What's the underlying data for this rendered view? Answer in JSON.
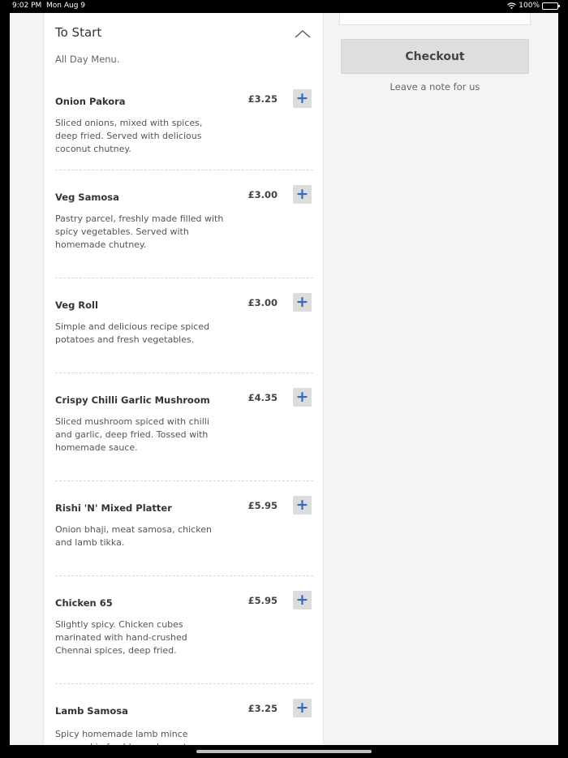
{
  "status": {
    "time": "9:02 PM",
    "date": "Mon Aug 9",
    "battery": "100%"
  },
  "section": {
    "title": "To Start",
    "subtitle": "All Day Menu."
  },
  "items": [
    {
      "name": "Onion Pakora",
      "price": "£3.25",
      "desc": "Sliced onions, mixed with spices, deep fried. Served with delicious coconut chutney."
    },
    {
      "name": "Veg Samosa",
      "price": "£3.00",
      "desc": "Pastry parcel, freshly made filled with spicy vegetables. Served with homemade chutney."
    },
    {
      "name": "Veg Roll",
      "price": "£3.00",
      "desc": "Simple and delicious recipe spiced potatoes and fresh vegetables."
    },
    {
      "name": "Crispy Chilli Garlic Mushroom",
      "price": "£4.35",
      "desc": "Sliced mushroom spiced with chilli and garlic, deep fried. Tossed with homemade sauce."
    },
    {
      "name": "Rishi 'N' Mixed Platter",
      "price": "£5.95",
      "desc": "Onion bhaji, meat samosa, chicken and lamb tikka."
    },
    {
      "name": "Chicken 65",
      "price": "£5.95",
      "desc": "Slightly spicy. Chicken cubes marinated with hand-crushed Chennai spices, deep fried."
    },
    {
      "name": "Lamb Samosa",
      "price": "£3.25",
      "desc": "Spicy homemade lamb mince encased in freshly made pastry."
    }
  ],
  "add_label": "+",
  "cart": {
    "checkout_label": "Checkout",
    "note_label": "Leave a note for us"
  },
  "colors": {
    "accent": "#2f6cc0",
    "button_bg": "#dcdcdc",
    "page_bg": "#f4f4f4"
  },
  "icons": {
    "collapse": "chevron-up-icon",
    "add": "plus-icon",
    "wifi": "wifi-icon",
    "battery": "battery-icon"
  }
}
